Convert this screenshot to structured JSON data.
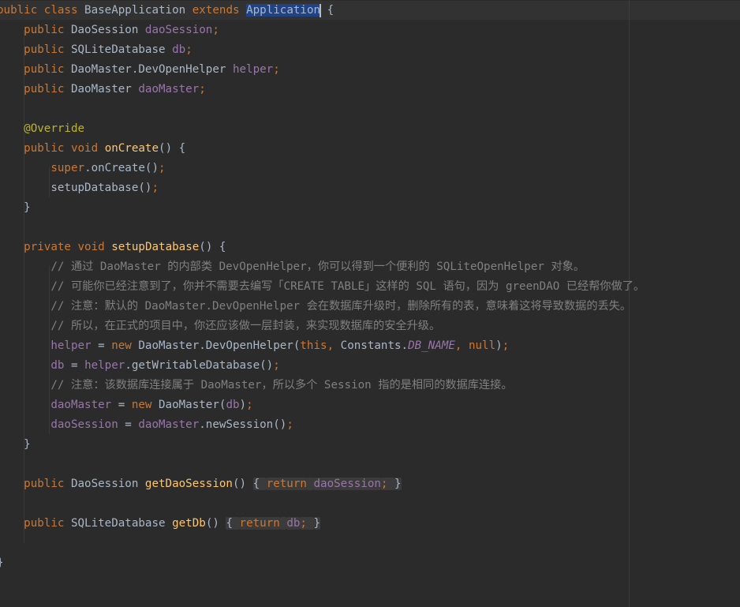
{
  "editor": {
    "lines": [
      {
        "tokens": [
          {
            "t": "public",
            "c": "kw"
          },
          {
            "t": " "
          },
          {
            "t": "class",
            "c": "kw"
          },
          {
            "t": " BaseApplication "
          },
          {
            "t": "extends",
            "c": "kw"
          },
          {
            "t": " "
          },
          {
            "t": "Application",
            "c": "sel"
          },
          {
            "caret": true
          },
          {
            "t": " {"
          }
        ]
      },
      {
        "tokens": [
          {
            "t": "    "
          },
          {
            "t": "public",
            "c": "kw"
          },
          {
            "t": " DaoSession "
          },
          {
            "t": "daoSession",
            "c": "field"
          },
          {
            "t": ";",
            "c": "kw"
          }
        ]
      },
      {
        "tokens": [
          {
            "t": "    "
          },
          {
            "t": "public",
            "c": "kw"
          },
          {
            "t": " SQLiteDatabase "
          },
          {
            "t": "db",
            "c": "field"
          },
          {
            "t": ";",
            "c": "kw"
          }
        ]
      },
      {
        "tokens": [
          {
            "t": "    "
          },
          {
            "t": "public",
            "c": "kw"
          },
          {
            "t": " DaoMaster.DevOpenHelper "
          },
          {
            "t": "helper",
            "c": "field"
          },
          {
            "t": ";",
            "c": "kw"
          }
        ]
      },
      {
        "tokens": [
          {
            "t": "    "
          },
          {
            "t": "public",
            "c": "kw"
          },
          {
            "t": " DaoMaster "
          },
          {
            "t": "daoMaster",
            "c": "field"
          },
          {
            "t": ";",
            "c": "kw"
          }
        ]
      },
      {
        "tokens": []
      },
      {
        "tokens": [
          {
            "t": "    "
          },
          {
            "t": "@Override",
            "c": "ann"
          }
        ]
      },
      {
        "tokens": [
          {
            "t": "    "
          },
          {
            "t": "public",
            "c": "kw"
          },
          {
            "t": " "
          },
          {
            "t": "void",
            "c": "kw"
          },
          {
            "t": " "
          },
          {
            "t": "onCreate",
            "c": "fn"
          },
          {
            "t": "() {"
          }
        ]
      },
      {
        "tokens": [
          {
            "t": "        "
          },
          {
            "t": "super",
            "c": "kw"
          },
          {
            "t": ".onCreate()"
          },
          {
            "t": ";",
            "c": "kw"
          }
        ]
      },
      {
        "tokens": [
          {
            "t": "        setupDatabase()"
          },
          {
            "t": ";",
            "c": "kw"
          }
        ]
      },
      {
        "tokens": [
          {
            "t": "    }"
          }
        ]
      },
      {
        "tokens": []
      },
      {
        "tokens": [
          {
            "t": "    "
          },
          {
            "t": "private",
            "c": "kw"
          },
          {
            "t": " "
          },
          {
            "t": "void",
            "c": "kw"
          },
          {
            "t": " "
          },
          {
            "t": "setupDatabase",
            "c": "fn"
          },
          {
            "t": "() {"
          }
        ]
      },
      {
        "tokens": [
          {
            "t": "        "
          },
          {
            "t": "// 通过 DaoMaster 的内部类 DevOpenHelper，你可以得到一个便利的 SQLiteOpenHelper 对象。",
            "c": "cmt"
          }
        ]
      },
      {
        "tokens": [
          {
            "t": "        "
          },
          {
            "t": "// 可能你已经注意到了，你并不需要去编写「CREATE TABLE」这样的 SQL 语句，因为 greenDAO 已经帮你做了。",
            "c": "cmt"
          }
        ]
      },
      {
        "tokens": [
          {
            "t": "        "
          },
          {
            "t": "// 注意：默认的 DaoMaster.DevOpenHelper 会在数据库升级时，删除所有的表，意味着这将导致数据的丢失。",
            "c": "cmt"
          }
        ]
      },
      {
        "tokens": [
          {
            "t": "        "
          },
          {
            "t": "// 所以，在正式的项目中，你还应该做一层封装，来实现数据库的安全升级。",
            "c": "cmt"
          }
        ]
      },
      {
        "tokens": [
          {
            "t": "        "
          },
          {
            "t": "helper",
            "c": "field"
          },
          {
            "t": " = "
          },
          {
            "t": "new",
            "c": "kw"
          },
          {
            "t": " DaoMaster.DevOpenHelper("
          },
          {
            "t": "this",
            "c": "kw"
          },
          {
            "t": ", ",
            "c": "kw"
          },
          {
            "t": "Constants."
          },
          {
            "t": "DB_NAME",
            "c": "const"
          },
          {
            "t": ", ",
            "c": "kw"
          },
          {
            "t": "null",
            "c": "kw"
          },
          {
            "t": ")"
          },
          {
            "t": ";",
            "c": "kw"
          }
        ]
      },
      {
        "tokens": [
          {
            "t": "        "
          },
          {
            "t": "db",
            "c": "field"
          },
          {
            "t": " = "
          },
          {
            "t": "helper",
            "c": "field"
          },
          {
            "t": ".getWritableDatabase()"
          },
          {
            "t": ";",
            "c": "kw"
          }
        ]
      },
      {
        "tokens": [
          {
            "t": "        "
          },
          {
            "t": "// 注意：该数据库连接属于 DaoMaster，所以多个 Session 指的是相同的数据库连接。",
            "c": "cmt"
          }
        ]
      },
      {
        "tokens": [
          {
            "t": "        "
          },
          {
            "t": "daoMaster",
            "c": "field"
          },
          {
            "t": " = "
          },
          {
            "t": "new",
            "c": "kw"
          },
          {
            "t": " DaoMaster("
          },
          {
            "t": "db",
            "c": "field"
          },
          {
            "t": ")"
          },
          {
            "t": ";",
            "c": "kw"
          }
        ]
      },
      {
        "tokens": [
          {
            "t": "        "
          },
          {
            "t": "daoSession",
            "c": "field"
          },
          {
            "t": " = "
          },
          {
            "t": "daoMaster",
            "c": "field"
          },
          {
            "t": ".newSession()"
          },
          {
            "t": ";",
            "c": "kw"
          }
        ]
      },
      {
        "tokens": [
          {
            "t": "    }"
          }
        ]
      },
      {
        "tokens": []
      },
      {
        "tokens": [
          {
            "t": "    "
          },
          {
            "t": "public",
            "c": "kw"
          },
          {
            "t": " DaoSession "
          },
          {
            "t": "getDaoSession",
            "c": "fn"
          },
          {
            "t": "() "
          },
          {
            "t": "{ ",
            "c": "fold"
          },
          {
            "t": "return",
            "c": "kw fold"
          },
          {
            "t": " ",
            "c": "fold"
          },
          {
            "t": "daoSession",
            "c": "field fold"
          },
          {
            "t": "; ",
            "c": "kw fold"
          },
          {
            "t": "}",
            "c": "fold"
          }
        ]
      },
      {
        "tokens": []
      },
      {
        "tokens": [
          {
            "t": "    "
          },
          {
            "t": "public",
            "c": "kw"
          },
          {
            "t": " SQLiteDatabase "
          },
          {
            "t": "getDb",
            "c": "fn"
          },
          {
            "t": "() "
          },
          {
            "t": "{ ",
            "c": "fold"
          },
          {
            "t": "return",
            "c": "kw fold"
          },
          {
            "t": " ",
            "c": "fold"
          },
          {
            "t": "db",
            "c": "field fold"
          },
          {
            "t": "; ",
            "c": "kw fold"
          },
          {
            "t": "}",
            "c": "fold"
          }
        ]
      },
      {
        "tokens": []
      },
      {
        "tokens": [
          {
            "t": "}"
          }
        ]
      }
    ]
  }
}
